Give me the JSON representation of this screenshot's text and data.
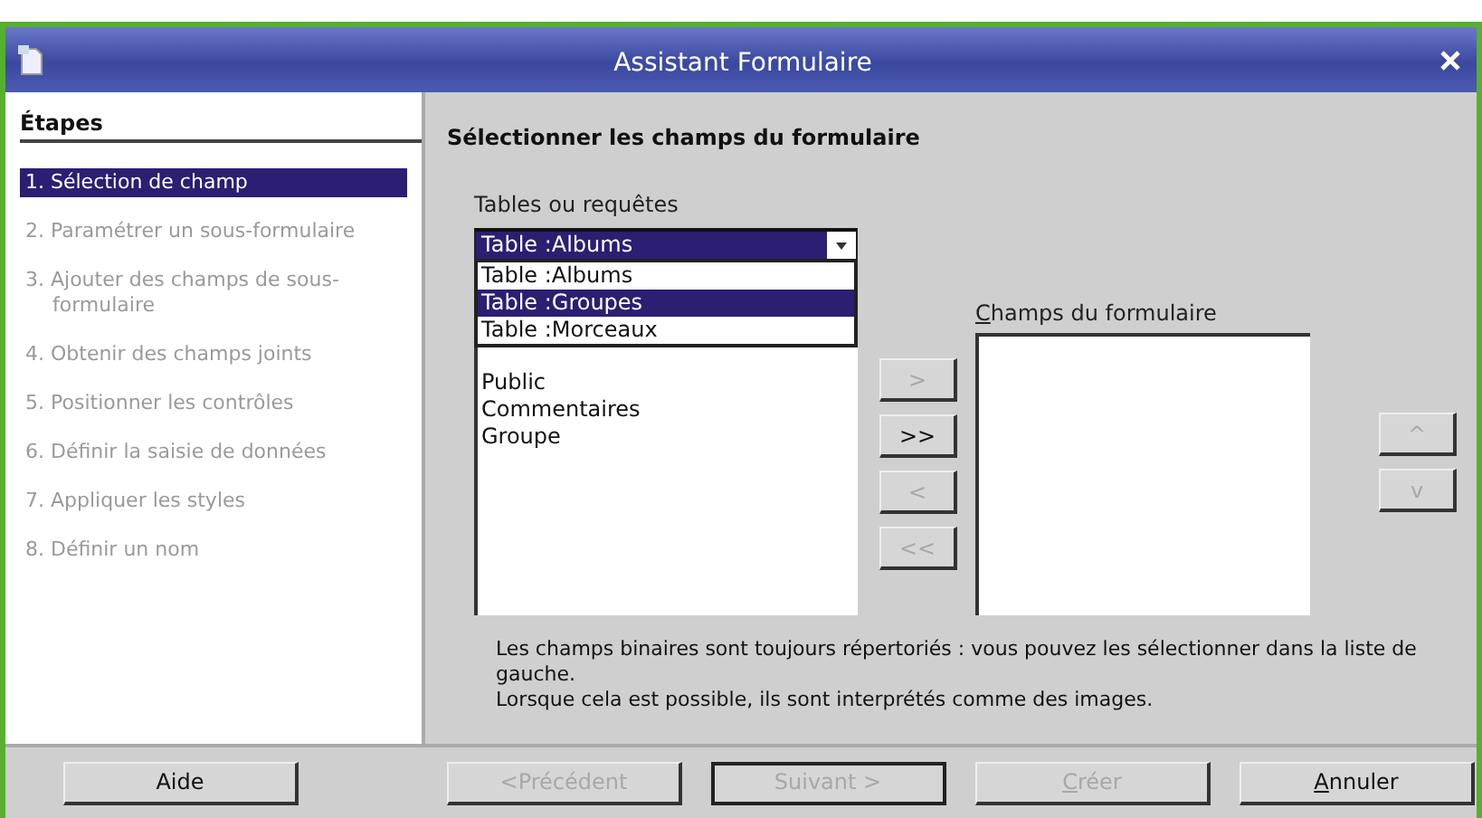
{
  "window": {
    "title": "Assistant Formulaire"
  },
  "steps_heading": "Étapes",
  "steps": [
    {
      "label": "1. Sélection de champ",
      "selected": true,
      "disabled": false
    },
    {
      "label": "2. Paramétrer un sous-formulaire",
      "selected": false,
      "disabled": true
    },
    {
      "label": "3. Ajouter des champs de sous-formulaire",
      "selected": false,
      "disabled": true
    },
    {
      "label": "4. Obtenir des champs joints",
      "selected": false,
      "disabled": true
    },
    {
      "label": "5. Positionner les contrôles",
      "selected": false,
      "disabled": true
    },
    {
      "label": "6. Définir la saisie de données",
      "selected": false,
      "disabled": true
    },
    {
      "label": "7. Appliquer les styles",
      "selected": false,
      "disabled": true
    },
    {
      "label": "8. Définir un nom",
      "selected": false,
      "disabled": true
    }
  ],
  "heading": "Sélectionner les champs du formulaire",
  "tables_label": "Tables ou requêtes",
  "tables_combo": {
    "value": "Table :Albums",
    "expanded": true
  },
  "tables_options": [
    {
      "label": "Table :Albums",
      "selected": false
    },
    {
      "label": "Table :Groupes",
      "selected": true
    },
    {
      "label": "Table :Morceaux",
      "selected": false
    }
  ],
  "available_fields": [
    "Public",
    "Commentaires",
    "Groupe"
  ],
  "move_buttons": [
    {
      "label": ">",
      "disabled": true
    },
    {
      "label": ">>",
      "disabled": false
    },
    {
      "label": "<",
      "disabled": true
    },
    {
      "label": "<<",
      "disabled": true
    }
  ],
  "form_fields_label": {
    "text": "Champs du formulaire",
    "mnemonic": true
  },
  "order_buttons": [
    {
      "label": "^",
      "disabled": true
    },
    {
      "label": "v",
      "disabled": true
    }
  ],
  "note": [
    "Les champs binaires sont toujours répertoriés : vous pouvez les sélectionner dans la liste de gauche.",
    "Lorsque cela est possible, ils sont interprétés comme des images."
  ],
  "buttons": [
    {
      "kind": "help",
      "label": "Aide",
      "disabled": false,
      "mnemonic": false
    },
    {
      "kind": "nav",
      "label": "<Précédent",
      "disabled": true,
      "mnemonic": false
    },
    {
      "kind": "nav",
      "label": "Suivant >",
      "disabled": true,
      "mnemonic": false
    },
    {
      "kind": "nav",
      "label": "Créer",
      "disabled": true,
      "mnemonic": true
    },
    {
      "kind": "nav",
      "label": "Annuler",
      "disabled": false,
      "mnemonic": true
    }
  ]
}
